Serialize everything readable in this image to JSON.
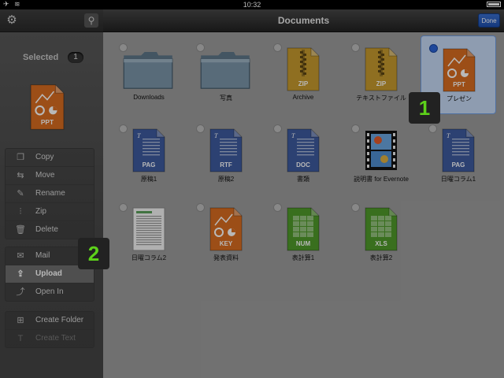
{
  "statusbar": {
    "time": "10:32"
  },
  "sidebar": {
    "selected_label": "Selected",
    "selected_count": "1",
    "preview_type": "PPT",
    "groups": [
      [
        {
          "label": "Copy",
          "icon": "copy-icon",
          "glyph": "❐"
        },
        {
          "label": "Move",
          "icon": "move-icon",
          "glyph": "⇆"
        },
        {
          "label": "Rename",
          "icon": "rename-icon",
          "glyph": "✎"
        },
        {
          "label": "Zip",
          "icon": "zip-icon",
          "glyph": "⫶"
        },
        {
          "label": "Delete",
          "icon": "trash-icon",
          "glyph": "🗑"
        }
      ],
      [
        {
          "label": "Mail",
          "icon": "mail-icon",
          "glyph": "✉"
        },
        {
          "label": "Upload",
          "icon": "upload-icon",
          "glyph": "⇪"
        },
        {
          "label": "Open In",
          "icon": "open-in-icon",
          "glyph": "⤴"
        }
      ],
      [
        {
          "label": "Create Folder",
          "icon": "create-folder-icon",
          "glyph": "⊞"
        },
        {
          "label": "Create Text",
          "icon": "create-text-icon",
          "glyph": "T"
        }
      ]
    ]
  },
  "main": {
    "title": "Documents",
    "done_label": "Done",
    "files": [
      {
        "label": "Downloads",
        "kind": "folder",
        "row": 0,
        "col": 0
      },
      {
        "label": "写真",
        "kind": "folder",
        "row": 0,
        "col": 1
      },
      {
        "label": "Archive",
        "kind": "zip",
        "type": "ZIP",
        "row": 0,
        "col": 2
      },
      {
        "label": "テキストファイル",
        "kind": "zip",
        "type": "ZIP",
        "row": 0,
        "col": 3
      },
      {
        "label": "プレゼン",
        "kind": "orange",
        "type": "PPT",
        "row": 0,
        "col": 4,
        "selected": true
      },
      {
        "label": "原稿1",
        "kind": "blue",
        "type": "PAG",
        "row": 1,
        "col": 0
      },
      {
        "label": "原稿2",
        "kind": "blue",
        "type": "RTF",
        "row": 1,
        "col": 1
      },
      {
        "label": "書類",
        "kind": "blue",
        "type": "DOC",
        "row": 1,
        "col": 2
      },
      {
        "label": "説明書 for Evernote",
        "kind": "video",
        "row": 1,
        "col": 3
      },
      {
        "label": "日曜コラム1",
        "kind": "blue",
        "type": "PAG",
        "row": 1,
        "col": 4
      },
      {
        "label": "日曜コラム2",
        "kind": "page",
        "row": 2,
        "col": 0
      },
      {
        "label": "発表資料",
        "kind": "orange",
        "type": "KEY",
        "row": 2,
        "col": 1
      },
      {
        "label": "表計算1",
        "kind": "green",
        "type": "NUM",
        "row": 2,
        "col": 2
      },
      {
        "label": "表計算2",
        "kind": "green",
        "type": "XLS",
        "row": 2,
        "col": 3
      }
    ]
  },
  "badges": [
    {
      "text": "1"
    },
    {
      "text": "2"
    }
  ],
  "colors": {
    "folder": "#7b95a8",
    "zip": "#c79a2f",
    "orange": "#d96d20",
    "blue": "#3d5a9e",
    "green": "#4f9a2a"
  }
}
